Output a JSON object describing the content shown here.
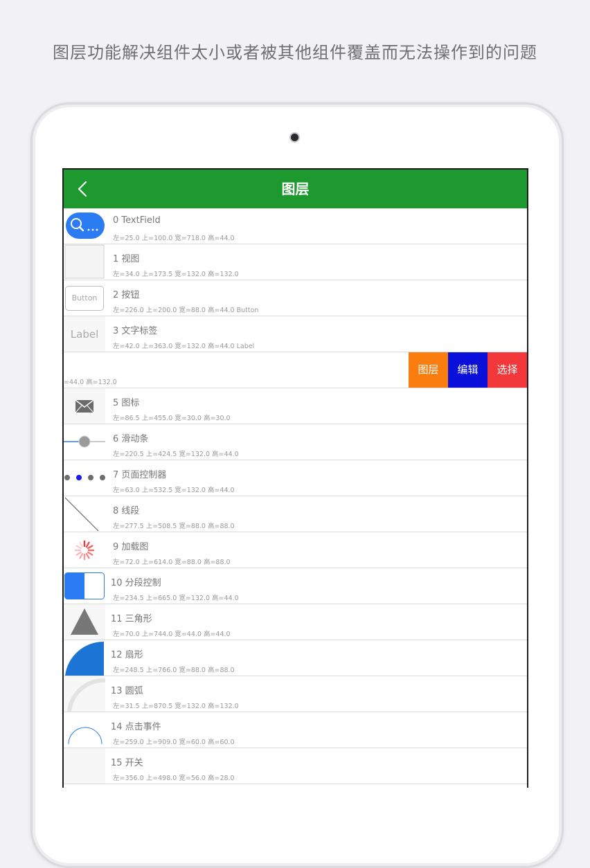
{
  "caption": "图层功能解决组件太小或者被其他组件覆盖而无法操作到的问题",
  "navbar": {
    "title": "图层",
    "back_icon": "chevron-left-icon"
  },
  "colors": {
    "navbar": "#1e9930",
    "action_layer": "#fa7d0f",
    "action_edit": "#0a10d9",
    "action_select": "#f2383a",
    "accent_blue": "#2b7cf2"
  },
  "swipe_actions": {
    "layer": "图层",
    "edit": "编辑",
    "select": "选择"
  },
  "rows": [
    {
      "title": "0  TextField",
      "sub": "左=25.0 上=100.0 宽=718.0 高=44.0",
      "thumb": "search-field"
    },
    {
      "title": "1  视图",
      "sub": "左=34.0 上=173.5 宽=132.0 高=132.0",
      "thumb": "view"
    },
    {
      "title": "2  按钮",
      "sub": "左=226.0 上=200.0 宽=88.0 高=44.0 Button",
      "thumb": "button",
      "thumb_text": "Button"
    },
    {
      "title": "3  文字标签",
      "sub": "左=42.0 上=363.0 宽=132.0 高=44.0 Label",
      "thumb": "label",
      "thumb_text": "Label"
    },
    {
      "title": "",
      "sub": "=44.0 高=132.0",
      "thumb": "none",
      "swiped": true
    },
    {
      "title": "5  图标",
      "sub": "左=86.5 上=455.0 宽=30.0 高=30.0",
      "thumb": "mail-icon"
    },
    {
      "title": "6  滑动条",
      "sub": "左=220.5 上=424.5 宽=132.0 高=44.0",
      "thumb": "slider"
    },
    {
      "title": "7  页面控制器",
      "sub": "左=63.0 上=532.5 宽=132.0 高=44.0",
      "thumb": "page-control"
    },
    {
      "title": "8  线段",
      "sub": "左=277.5 上=508.5 宽=88.0 高=88.0",
      "thumb": "line"
    },
    {
      "title": "9  加载图",
      "sub": "左=72.0 上=614.0 宽=88.0 高=88.0",
      "thumb": "spinner"
    },
    {
      "title": "10 分段控制",
      "sub": "左=234.5 上=665.0 宽=132.0 高=44.0",
      "thumb": "segmented"
    },
    {
      "title": "11 三角形",
      "sub": "左=70.0 上=744.0 宽=44.0 高=44.0",
      "thumb": "triangle"
    },
    {
      "title": "12 扇形",
      "sub": "左=248.5 上=766.0 宽=88.0 高=88.0",
      "thumb": "sector"
    },
    {
      "title": "13 圆弧",
      "sub": "左=31.5 上=870.5 宽=132.0 高=132.0",
      "thumb": "arc"
    },
    {
      "title": "14 点击事件",
      "sub": "左=259.0 上=909.0 宽=60.0 高=60.0",
      "thumb": "circle"
    },
    {
      "title": "15 开关",
      "sub": "左=356.0 上=498.0 宽=56.0 高=28.0",
      "thumb": "switch"
    }
  ]
}
